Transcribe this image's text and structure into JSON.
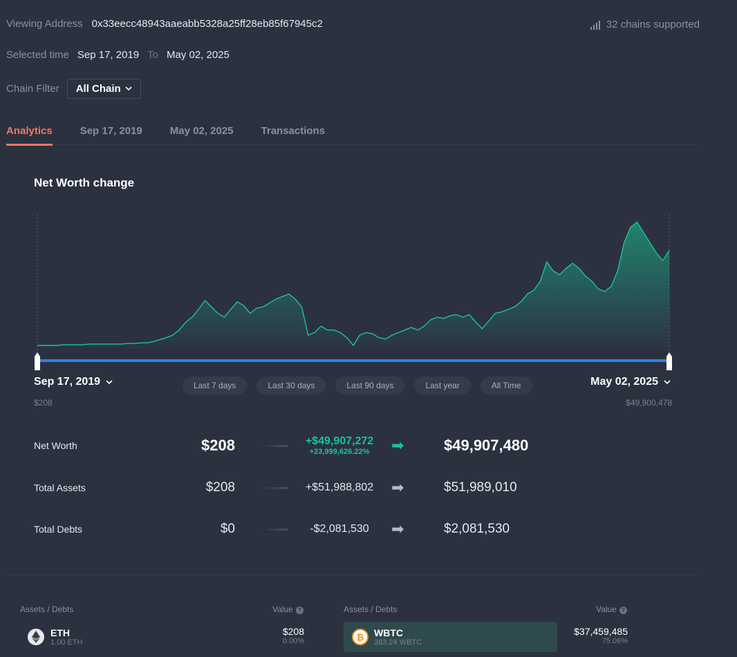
{
  "header": {
    "viewing_label": "Viewing Address",
    "address": "0x33eecc48943aaeabb5328a25ff28eb85f67945c2",
    "chains_supported": "32 chains supported",
    "selected_time_label": "Selected time",
    "start_date": "Sep 17, 2019",
    "to_label": "To",
    "end_date": "May 02, 2025",
    "chain_filter_label": "Chain Filter",
    "chain_filter_value": "All Chain"
  },
  "tabs": [
    {
      "label": "Analytics",
      "active": true
    },
    {
      "label": "Sep 17, 2019",
      "active": false
    },
    {
      "label": "May 02, 2025",
      "active": false
    },
    {
      "label": "Transactions",
      "active": false
    }
  ],
  "chart": {
    "title": "Net Worth change",
    "start_label": "Sep 17, 2019",
    "start_value": "$208",
    "end_label": "May 02, 2025",
    "end_value": "$49,900,478",
    "ranges": [
      "Last 7 days",
      "Last 30 days",
      "Last 90 days",
      "Last year",
      "All Time"
    ],
    "line_color": "#19c596",
    "selection_color": "#2f80ed"
  },
  "chart_data": {
    "type": "area",
    "x": [
      "Sep 17, 2019",
      "May 02, 2025"
    ],
    "values_relative": [
      0.0,
      0.0,
      0.0,
      0.0,
      0.005,
      0.005,
      0.005,
      0.005,
      0.01,
      0.01,
      0.01,
      0.01,
      0.01,
      0.01,
      0.015,
      0.015,
      0.02,
      0.02,
      0.03,
      0.045,
      0.06,
      0.08,
      0.12,
      0.18,
      0.22,
      0.28,
      0.35,
      0.3,
      0.25,
      0.22,
      0.28,
      0.34,
      0.31,
      0.25,
      0.29,
      0.3,
      0.33,
      0.36,
      0.38,
      0.4,
      0.36,
      0.3,
      0.08,
      0.1,
      0.15,
      0.12,
      0.12,
      0.1,
      0.06,
      0.0,
      0.08,
      0.1,
      0.09,
      0.06,
      0.05,
      0.08,
      0.1,
      0.12,
      0.14,
      0.12,
      0.15,
      0.2,
      0.22,
      0.21,
      0.23,
      0.24,
      0.22,
      0.24,
      0.18,
      0.13,
      0.19,
      0.25,
      0.26,
      0.28,
      0.3,
      0.34,
      0.4,
      0.43,
      0.5,
      0.65,
      0.58,
      0.55,
      0.6,
      0.64,
      0.6,
      0.54,
      0.5,
      0.44,
      0.42,
      0.46,
      0.58,
      0.8,
      0.92,
      0.96,
      0.88,
      0.8,
      0.72,
      0.66,
      0.74
    ],
    "title": "Net Worth change"
  },
  "summary": {
    "net_worth": {
      "label": "Net Worth",
      "from": "$208",
      "change": "+$49,907,272",
      "pct": "+23,999,626.22%",
      "to": "$49,907,480"
    },
    "total_assets": {
      "label": "Total Assets",
      "from": "$208",
      "change": "+$51,988,802",
      "to": "$51,989,010"
    },
    "total_debts": {
      "label": "Total Debts",
      "from": "$0",
      "change": "-$2,081,530",
      "to": "$2,081,530"
    }
  },
  "table": {
    "left": {
      "header_assets": "Assets / Debts",
      "header_value": "Value",
      "row": {
        "name": "ETH",
        "amount": "1.00 ETH",
        "value": "$208",
        "share": "0.00%",
        "icon": "eth-icon"
      }
    },
    "right": {
      "header_assets": "Assets / Debts",
      "header_value": "Value",
      "row": {
        "name": "WBTC",
        "amount": "383.24 WBTC",
        "value": "$37,459,485",
        "share": "75.06%",
        "icon": "btc-icon"
      }
    }
  }
}
